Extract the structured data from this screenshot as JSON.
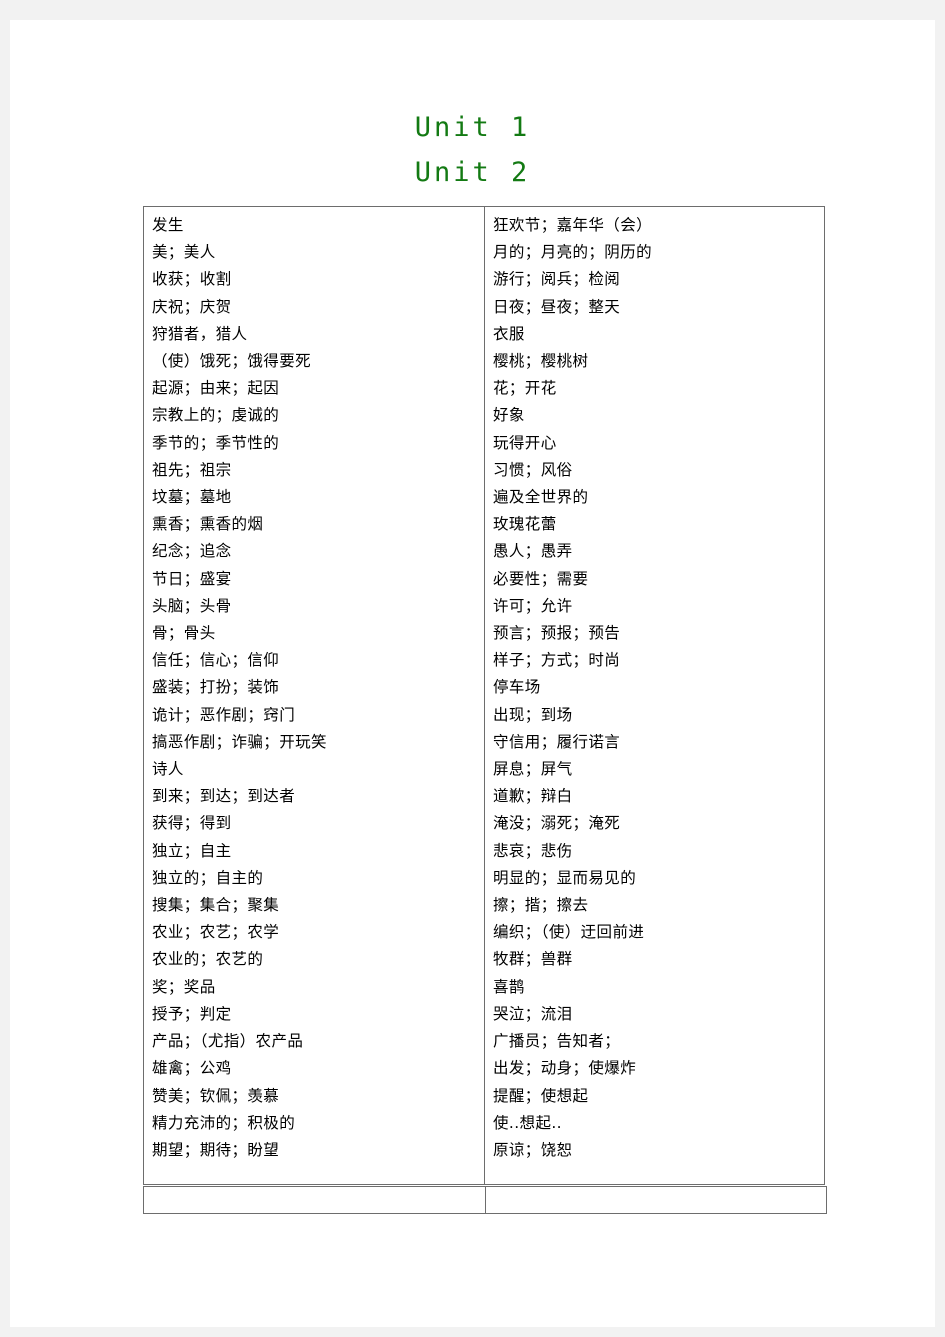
{
  "document": {
    "headings": [
      {
        "text": "Unit 1",
        "color": "#137a13"
      },
      {
        "text": "Unit 2",
        "color": "#137a13"
      }
    ],
    "table": {
      "columns": [
        {
          "name": "unit-1-column",
          "entries": [
            "发生",
            "美；美人",
            "收获；收割",
            "庆祝；庆贺",
            "狩猎者，猎人",
            "（使）饿死；饿得要死",
            "起源；由来；起因",
            "宗教上的；虔诚的",
            "季节的；季节性的",
            "祖先；祖宗",
            "坟墓；墓地",
            "熏香；熏香的烟",
            "纪念；追念",
            "节日；盛宴",
            "头脑；头骨",
            "骨；骨头",
            "信任；信心；信仰",
            "盛装；打扮；装饰",
            "诡计；恶作剧；窍门",
            "搞恶作剧；诈骗；开玩笑",
            "诗人",
            "到来；到达；到达者",
            "获得；得到",
            "独立；自主",
            "独立的；自主的",
            "搜集；集合；聚集",
            "农业；农艺；农学",
            "农业的；农艺的",
            "奖；奖品",
            "授予；判定",
            "产品；（尤指）农产品",
            "雄禽；公鸡",
            "赞美；钦佩；羡慕",
            "精力充沛的；积极的",
            "期望；期待；盼望"
          ]
        },
        {
          "name": "unit-2-column",
          "entries": [
            "狂欢节；嘉年华（会）",
            "月的；月亮的；阴历的",
            "游行；阅兵；检阅",
            "日夜；昼夜；整天",
            "衣服",
            "樱桃；樱桃树",
            "花；开花",
            "好象",
            "玩得开心",
            "习惯；风俗",
            "遍及全世界的",
            "玫瑰花蕾",
            "愚人；愚弄",
            "必要性；需要",
            "许可；允许",
            "预言；预报；预告",
            "样子；方式；时尚",
            "停车场",
            "出现；到场",
            "守信用；履行诺言",
            "屏息；屏气",
            "道歉；辩白",
            "淹没；溺死；淹死",
            "悲哀；悲伤",
            "明显的；显而易见的",
            "擦；揩；擦去",
            "编织；（使）迂回前进",
            "牧群；兽群",
            "喜鹊",
            "哭泣；流泪",
            "广播员；告知者；",
            "出发；动身；使爆炸",
            "提醒；使想起",
            "使..想起..",
            "原谅；饶恕"
          ]
        }
      ]
    },
    "tail_table": {
      "cells": [
        "",
        ""
      ]
    }
  }
}
